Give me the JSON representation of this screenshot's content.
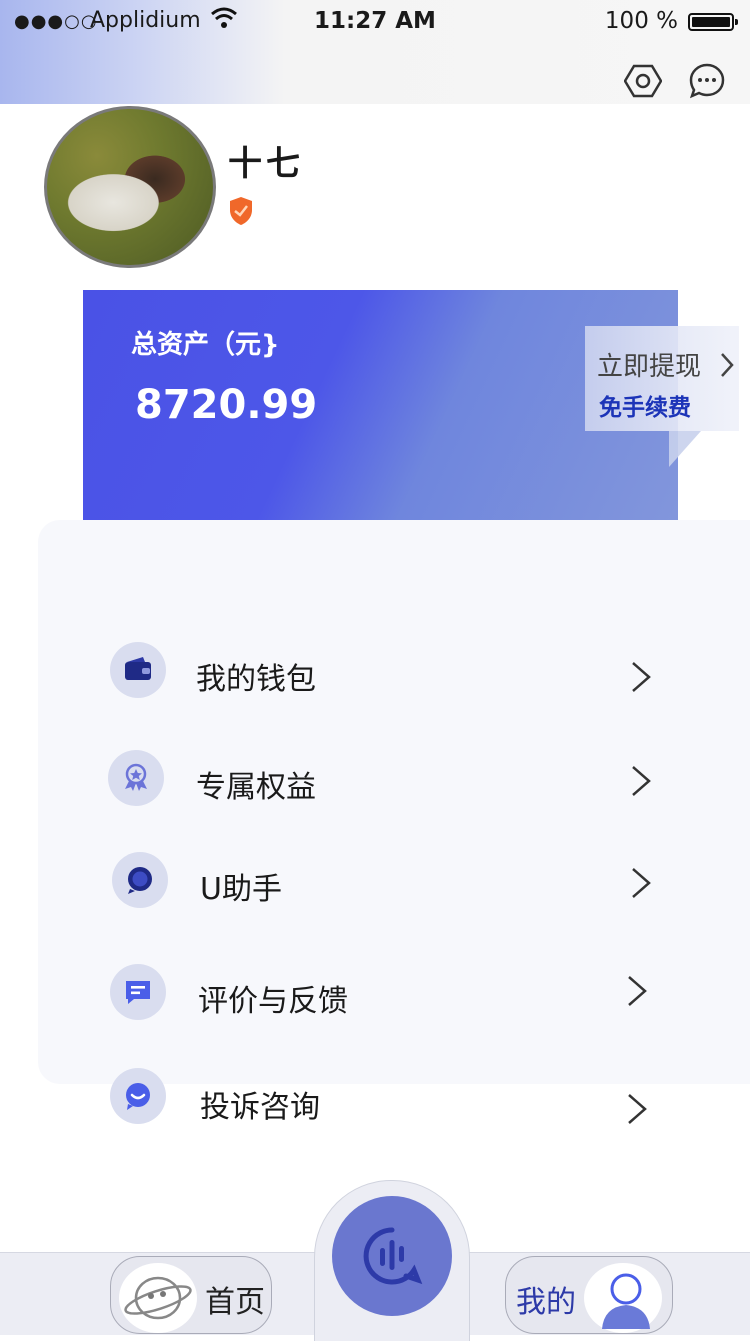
{
  "status_bar": {
    "signal": "●●●○○",
    "carrier": "Applidium",
    "time": "11:27 AM",
    "battery": "100 %"
  },
  "header_icons": [
    "settings-hexagon-icon",
    "message-bubble-icon"
  ],
  "profile": {
    "name": "十七",
    "badge_icon": "verified-shield-icon"
  },
  "assets": {
    "label": "总资产（元}",
    "value": "8720.99"
  },
  "tip": {
    "withdraw": "立即提现",
    "renew": "免手续费"
  },
  "menu": [
    {
      "label": "我的钱包",
      "icon": "wallet-icon"
    },
    {
      "label": "专属权益",
      "icon": "medal-icon"
    },
    {
      "label": "U助手",
      "icon": "chat-assistant-icon"
    },
    {
      "label": "评价与反馈",
      "icon": "feedback-icon"
    },
    {
      "label": "投诉咨询",
      "icon": "consult-icon"
    }
  ],
  "tabbar": {
    "home": "首页",
    "center_icon": "voice-assistant-icon",
    "mine": "我的"
  },
  "colors": {
    "card_blue": "#4a52e6",
    "accent_text": "#1c34b8",
    "tab_center": "#6a77cf"
  }
}
